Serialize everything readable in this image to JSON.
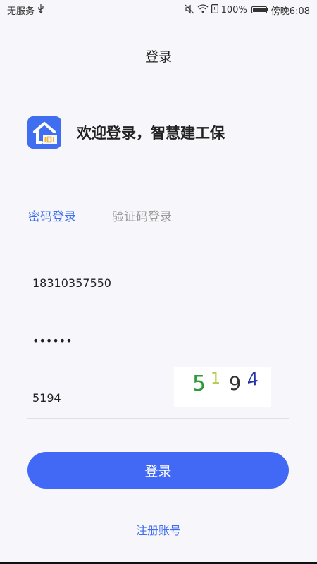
{
  "status_bar": {
    "carrier": "无服务",
    "battery_percent": "100%",
    "time": "傍晚6:08",
    "battery_level": 1.0,
    "icons": [
      "usb-icon",
      "mute-icon",
      "wifi-icon",
      "sim-icon",
      "battery-icon"
    ]
  },
  "header": {
    "title": "登录"
  },
  "brand": {
    "welcome": "欢迎登录，智慧建工保",
    "logo_icon": "house-logo-icon"
  },
  "tabs": [
    {
      "label": "密码登录",
      "active": true
    },
    {
      "label": "验证码登录",
      "active": false
    }
  ],
  "form": {
    "phone": {
      "value": "18310357550"
    },
    "password": {
      "value": "••••••"
    },
    "captcha": {
      "value": "5194",
      "image_text": "5194"
    }
  },
  "actions": {
    "login_label": "登录",
    "register_label": "注册账号"
  },
  "colors": {
    "accent": "#3f6ff0",
    "button": "#4169f5",
    "background": "#f7f6fa"
  }
}
